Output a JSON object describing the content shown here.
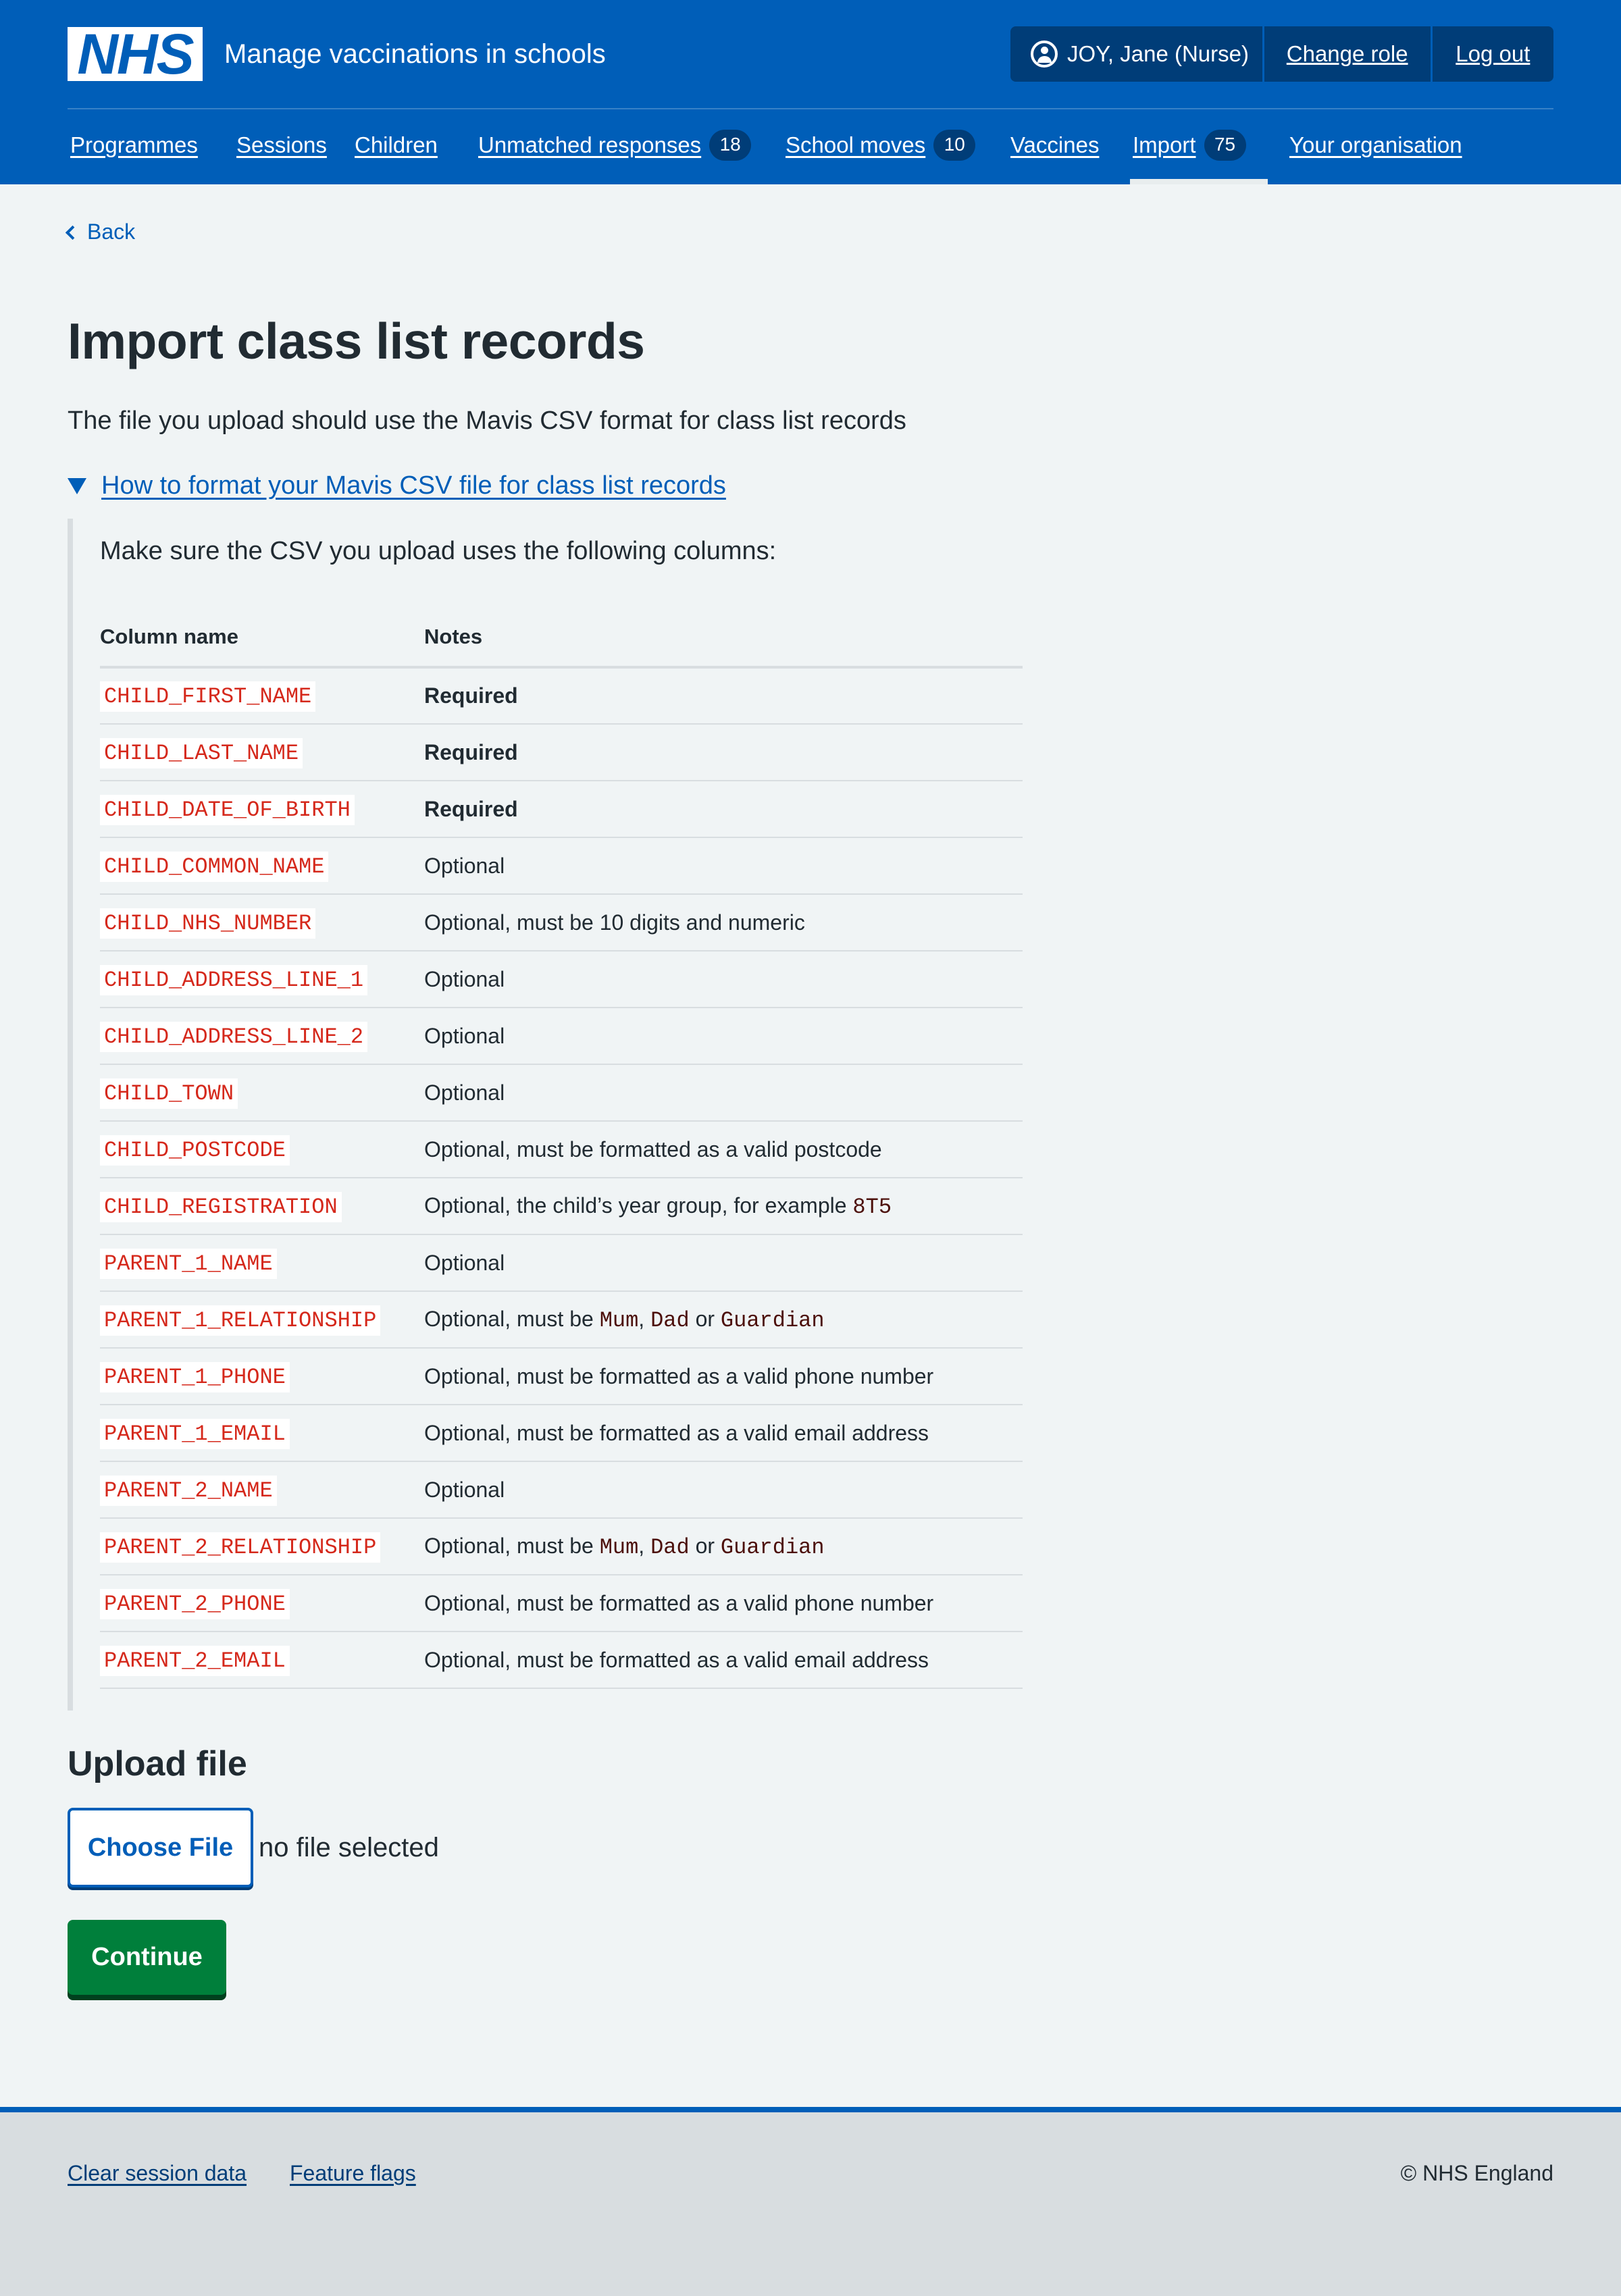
{
  "header": {
    "logo_text": "NHS",
    "service_name": "Manage vaccinations in schools",
    "user": "JOY, Jane (Nurse)",
    "change_role": "Change role",
    "log_out": "Log out",
    "brand_color": "#005eb8"
  },
  "nav": {
    "items": [
      {
        "label": "Programmes"
      },
      {
        "label": "Sessions"
      },
      {
        "label": "Children"
      },
      {
        "label": "Unmatched responses",
        "count": "18"
      },
      {
        "label": "School moves",
        "count": "10"
      },
      {
        "label": "Vaccines"
      },
      {
        "label": "Import",
        "count": "75",
        "active": true
      },
      {
        "label": "Your organisation"
      }
    ]
  },
  "back_label": "Back",
  "page": {
    "title": "Import class list records",
    "lead": "The file you upload should use the Mavis CSV format for class list records"
  },
  "details": {
    "summary": "How to format your Mavis CSV file for class list records",
    "intro": "Make sure the CSV you upload uses the following columns:",
    "headers": {
      "column": "Column name",
      "notes": "Notes"
    },
    "rows": [
      {
        "column": "CHILD_FIRST_NAME",
        "notes": "Required"
      },
      {
        "column": "CHILD_LAST_NAME",
        "notes": "Required"
      },
      {
        "column": "CHILD_DATE_OF_BIRTH",
        "notes": "Required"
      },
      {
        "column": "CHILD_COMMON_NAME",
        "notes": "Optional"
      },
      {
        "column": "CHILD_NHS_NUMBER",
        "notes": "Optional, must be 10 digits and numeric"
      },
      {
        "column": "CHILD_ADDRESS_LINE_1",
        "notes": "Optional"
      },
      {
        "column": "CHILD_ADDRESS_LINE_2",
        "notes": "Optional"
      },
      {
        "column": "CHILD_TOWN",
        "notes": "Optional"
      },
      {
        "column": "CHILD_POSTCODE",
        "notes": "Optional, must be formatted as a valid postcode"
      },
      {
        "column": "CHILD_REGISTRATION",
        "notes": "Optional, the child’s year group, for example",
        "code": "8T5"
      },
      {
        "column": "PARENT_1_NAME",
        "notes": "Optional"
      },
      {
        "column": "PARENT_1_RELATIONSHIP",
        "notes": "Optional, must be",
        "options": [
          "Mum",
          "Dad",
          "Guardian"
        ],
        "sep": ",",
        "conj": "or"
      },
      {
        "column": "PARENT_1_PHONE",
        "notes": "Optional, must be formatted as a valid phone number"
      },
      {
        "column": "PARENT_1_EMAIL",
        "notes": "Optional, must be formatted as a valid email address"
      },
      {
        "column": "PARENT_2_NAME",
        "notes": "Optional"
      },
      {
        "column": "PARENT_2_RELATIONSHIP",
        "notes": "Optional, must be",
        "options": [
          "Mum",
          "Dad",
          "Guardian"
        ],
        "sep": ",",
        "conj": "or"
      },
      {
        "column": "PARENT_2_PHONE",
        "notes": "Optional, must be formatted as a valid phone number"
      },
      {
        "column": "PARENT_2_EMAIL",
        "notes": "Optional, must be formatted as a valid email address"
      }
    ]
  },
  "upload": {
    "heading": "Upload file",
    "choose_label": "Choose File",
    "no_file": "no file selected",
    "continue_label": "Continue"
  },
  "footer": {
    "links": [
      "Clear session data",
      "Feature flags"
    ],
    "copyright": "© NHS England"
  }
}
